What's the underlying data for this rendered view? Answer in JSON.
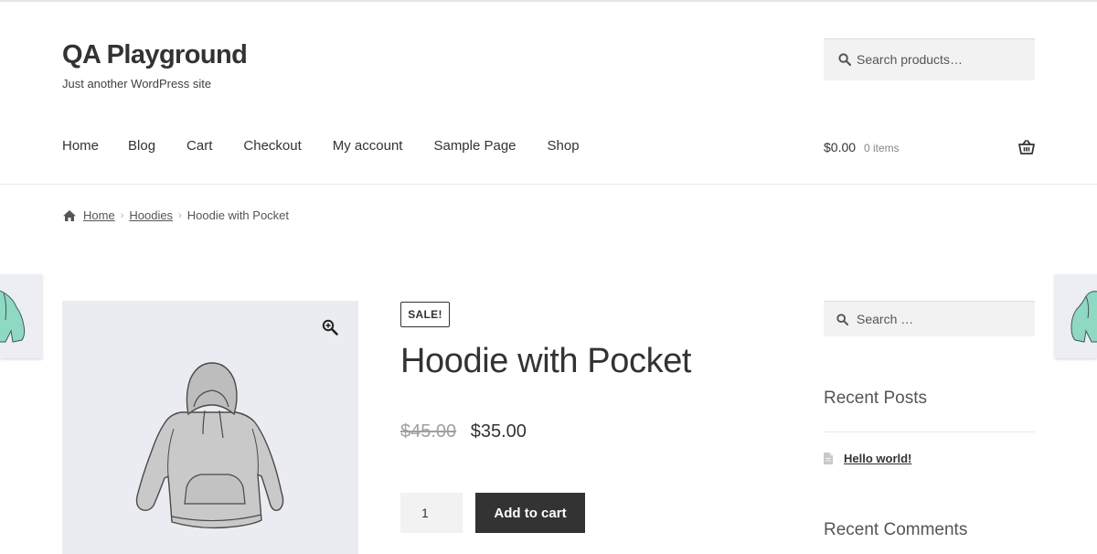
{
  "site": {
    "title": "QA Playground",
    "tagline": "Just another WordPress site"
  },
  "header_search": {
    "placeholder": "Search products…"
  },
  "nav": {
    "items": [
      "Home",
      "Blog",
      "Cart",
      "Checkout",
      "My account",
      "Sample Page",
      "Shop"
    ]
  },
  "cart": {
    "amount": "$0.00",
    "count": "0 items"
  },
  "breadcrumb": {
    "home": "Home",
    "category": "Hoodies",
    "current": "Hoodie with Pocket"
  },
  "product": {
    "badge": "SALE!",
    "title": "Hoodie with Pocket",
    "regular_price": "$45.00",
    "sale_price": "$35.00",
    "quantity": "1",
    "add_to_cart": "Add to cart"
  },
  "sidebar": {
    "search_placeholder": "Search …",
    "recent_posts_title": "Recent Posts",
    "recent_posts": [
      "Hello world!"
    ],
    "recent_comments_title": "Recent Comments"
  },
  "icons": {
    "search": "search-icon",
    "basket": "basket-icon",
    "home": "home-icon",
    "zoom": "zoom-in-icon",
    "document": "document-icon"
  },
  "colors": {
    "text_dark": "#333333",
    "button_bg": "#333333",
    "field_bg": "#f2f2f2",
    "gallery_bg": "#eaecf1",
    "old_price": "#a0a0a0"
  }
}
